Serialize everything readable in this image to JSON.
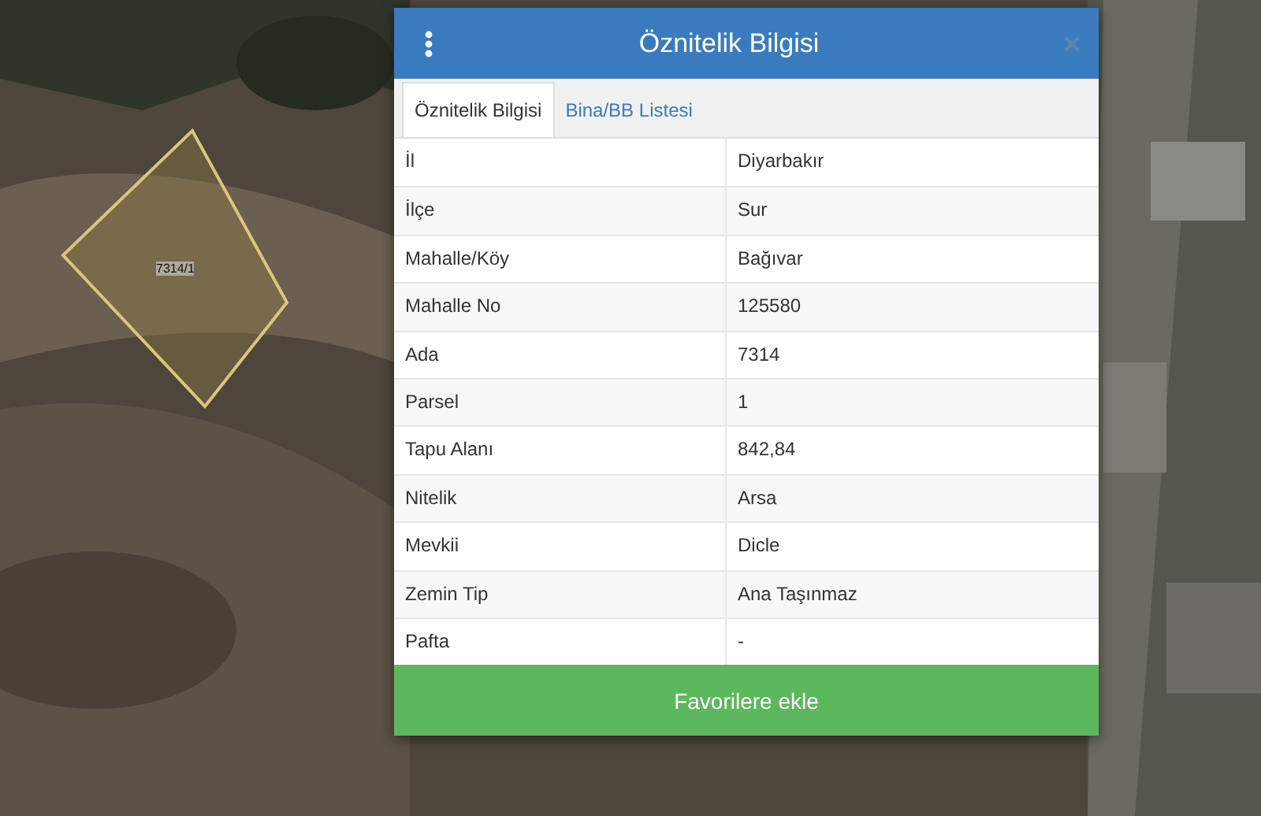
{
  "map": {
    "parcel": {
      "label": "7314/1"
    }
  },
  "dialog": {
    "title": "Öznitelik Bilgisi",
    "tabs": [
      {
        "label": "Öznitelik Bilgisi",
        "selected": true
      },
      {
        "label": "Bina/BB Listesi",
        "selected": false
      }
    ],
    "rows": [
      {
        "field": "İl",
        "value": "Diyarbakır"
      },
      {
        "field": "İlçe",
        "value": "Sur"
      },
      {
        "field": "Mahalle/Köy",
        "value": "Bağıvar"
      },
      {
        "field": "Mahalle No",
        "value": "125580"
      },
      {
        "field": "Ada",
        "value": "7314"
      },
      {
        "field": "Parsel",
        "value": "1"
      },
      {
        "field": "Tapu Alanı",
        "value": "842,84"
      },
      {
        "field": "Nitelik",
        "value": "Arsa"
      },
      {
        "field": "Mevkii",
        "value": "Dicle"
      },
      {
        "field": "Zemin Tip",
        "value": "Ana Taşınmaz"
      },
      {
        "field": "Pafta",
        "value": "-"
      }
    ],
    "button": "Favorilere ekle"
  }
}
